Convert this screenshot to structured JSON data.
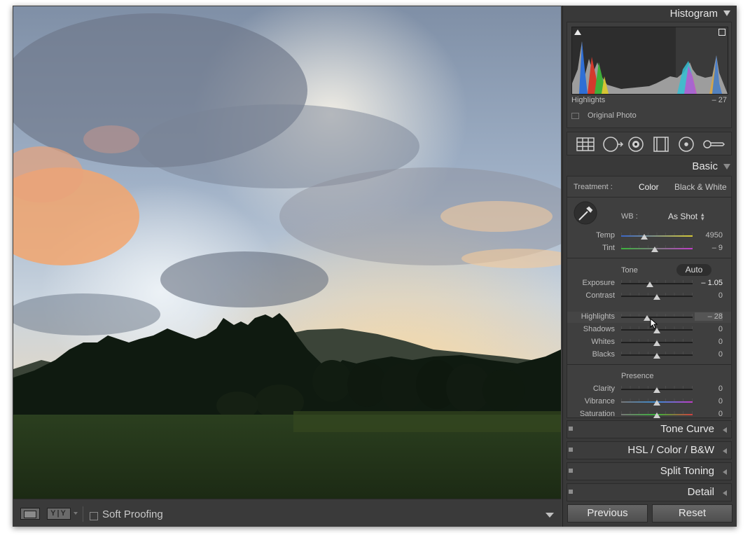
{
  "toolbar": {
    "view_mode_icon": "loupe-view-icon",
    "compare_icon": "before-after-icon",
    "compare_label": "Y|Y",
    "soft_proofing_label": "Soft Proofing",
    "soft_proofing_checked": false,
    "menu_icon": "toolbar-menu-icon"
  },
  "histogram": {
    "title": "Histogram",
    "info_label": "Highlights",
    "info_value": "– 27",
    "original_photo_label": "Original Photo",
    "original_photo_checked": false
  },
  "tools": [
    "crop-overlay-icon",
    "spot-removal-icon",
    "red-eye-icon",
    "graduated-filter-icon",
    "radial-filter-icon",
    "adjustment-brush-icon"
  ],
  "basic": {
    "title": "Basic",
    "treatment_label": "Treatment :",
    "treatment_options": [
      "Color",
      "Black & White"
    ],
    "treatment_selected": "Color",
    "wb_label": "WB :",
    "wb_value": "As Shot",
    "white_balance": [
      {
        "label": "Temp",
        "value": "4950",
        "position": 0.32
      },
      {
        "label": "Tint",
        "value": "– 9",
        "position": 0.47
      }
    ],
    "tone_label": "Tone",
    "auto_label": "Auto",
    "tone_top": [
      {
        "label": "Exposure",
        "value": "– 1.05",
        "position": 0.4
      },
      {
        "label": "Contrast",
        "value": "0",
        "position": 0.5
      }
    ],
    "tone_bottom": [
      {
        "label": "Highlights",
        "value": "– 28",
        "position": 0.36
      },
      {
        "label": "Shadows",
        "value": "0",
        "position": 0.5
      },
      {
        "label": "Whites",
        "value": "0",
        "position": 0.5
      },
      {
        "label": "Blacks",
        "value": "0",
        "position": 0.5
      }
    ],
    "presence_label": "Presence",
    "presence": [
      {
        "label": "Clarity",
        "value": "0",
        "position": 0.5
      },
      {
        "label": "Vibrance",
        "value": "0",
        "position": 0.5
      },
      {
        "label": "Saturation",
        "value": "0",
        "position": 0.5
      }
    ]
  },
  "panels": [
    {
      "title": "Tone Curve"
    },
    {
      "title": "HSL / Color / B&W"
    },
    {
      "title": "Split Toning"
    },
    {
      "title": "Detail"
    }
  ],
  "buttons": {
    "previous": "Previous",
    "reset": "Reset"
  }
}
